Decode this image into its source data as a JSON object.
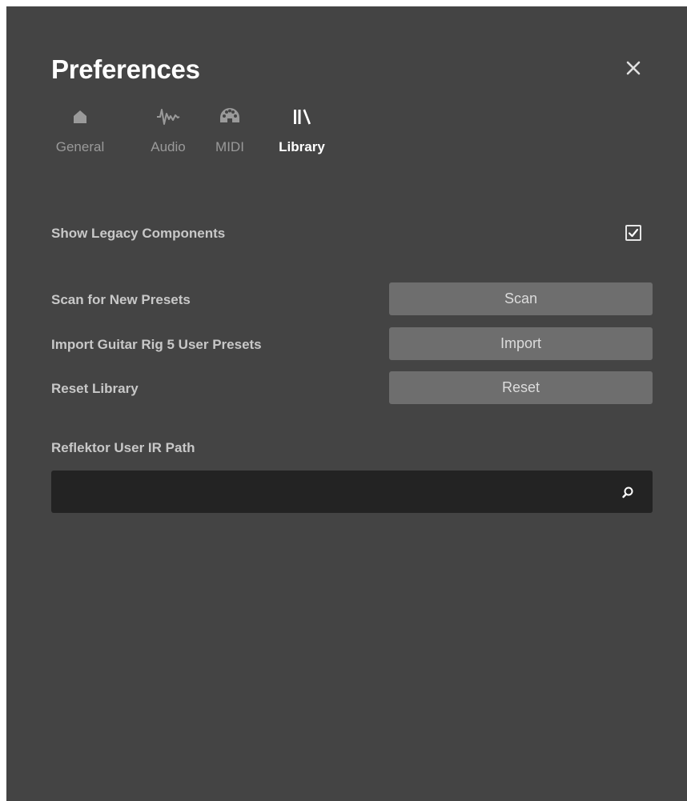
{
  "dialog": {
    "title": "Preferences",
    "close_icon": "close-icon"
  },
  "tabs": [
    {
      "label": "General",
      "icon": "home-icon",
      "active": false
    },
    {
      "label": "Audio",
      "icon": "waveform-icon",
      "active": false
    },
    {
      "label": "MIDI",
      "icon": "midi-connector-icon",
      "active": false
    },
    {
      "label": "Library",
      "icon": "library-icon",
      "active": true
    }
  ],
  "library": {
    "legacy": {
      "label": "Show Legacy Components",
      "checked": true
    },
    "scan": {
      "label": "Scan for New Presets",
      "button": "Scan"
    },
    "import": {
      "label": "Import Guitar Rig 5 User Presets",
      "button": "Import"
    },
    "reset": {
      "label": "Reset Library",
      "button": "Reset"
    },
    "ir_path": {
      "label": "Reflektor User IR Path",
      "value": "",
      "search_icon": "search-icon"
    }
  },
  "colors": {
    "panel": "#444444",
    "button": "#6e6e6e",
    "field": "#232323",
    "title": "#ffffff"
  }
}
